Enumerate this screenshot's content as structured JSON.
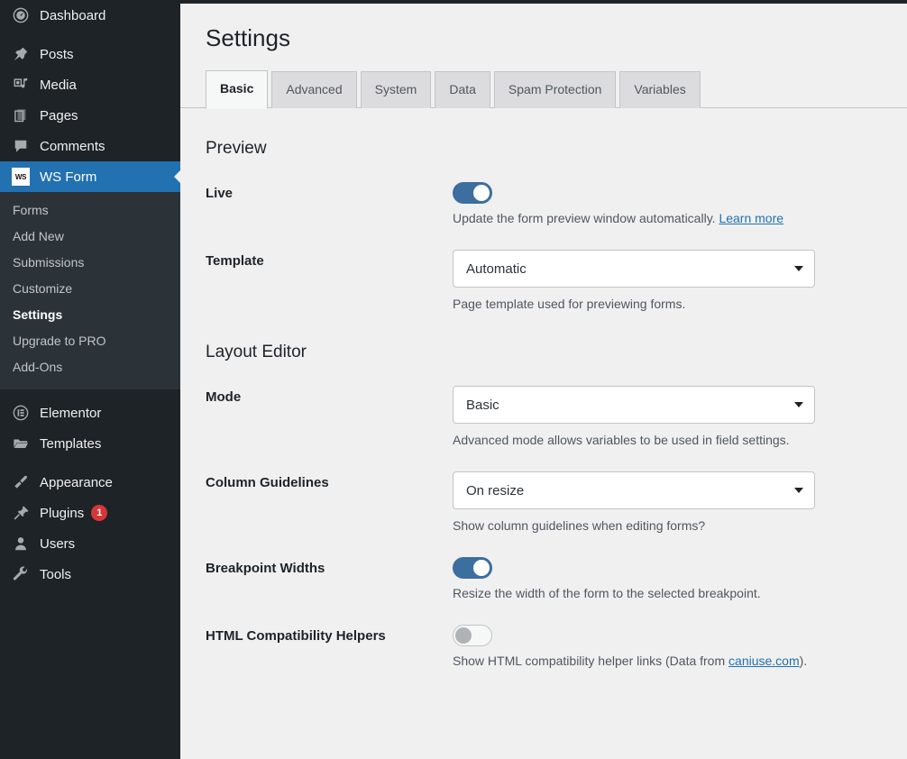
{
  "sidebar": {
    "items": [
      {
        "label": "Dashboard",
        "icon": "dashboard-icon",
        "current": false
      },
      {
        "label": "Posts",
        "icon": "pin-icon",
        "current": false
      },
      {
        "label": "Media",
        "icon": "media-icon",
        "current": false
      },
      {
        "label": "Pages",
        "icon": "pages-icon",
        "current": false
      },
      {
        "label": "Comments",
        "icon": "comments-icon",
        "current": false
      },
      {
        "label": "WS Form",
        "icon": "ws-form-icon",
        "current": true
      },
      {
        "label": "Elementor",
        "icon": "elementor-icon",
        "current": false
      },
      {
        "label": "Templates",
        "icon": "templates-icon",
        "current": false
      },
      {
        "label": "Appearance",
        "icon": "appearance-icon",
        "current": false
      },
      {
        "label": "Plugins",
        "icon": "plugins-icon",
        "current": false,
        "badge": "1"
      },
      {
        "label": "Users",
        "icon": "users-icon",
        "current": false
      },
      {
        "label": "Tools",
        "icon": "tools-icon",
        "current": false
      }
    ],
    "ws_form_badge_text": "WS",
    "submenu": [
      {
        "label": "Forms",
        "current": false
      },
      {
        "label": "Add New",
        "current": false
      },
      {
        "label": "Submissions",
        "current": false
      },
      {
        "label": "Customize",
        "current": false
      },
      {
        "label": "Settings",
        "current": true
      },
      {
        "label": "Upgrade to PRO",
        "current": false
      },
      {
        "label": "Add-Ons",
        "current": false
      }
    ]
  },
  "page": {
    "title": "Settings",
    "tabs": [
      {
        "label": "Basic",
        "active": true
      },
      {
        "label": "Advanced",
        "active": false
      },
      {
        "label": "System",
        "active": false
      },
      {
        "label": "Data",
        "active": false
      },
      {
        "label": "Spam Protection",
        "active": false
      },
      {
        "label": "Variables",
        "active": false
      }
    ]
  },
  "preview": {
    "heading": "Preview",
    "live": {
      "label": "Live",
      "state": "on",
      "help_text": "Update the form preview window automatically.",
      "help_link": "Learn more"
    },
    "template": {
      "label": "Template",
      "value": "Automatic",
      "help_text": "Page template used for previewing forms."
    }
  },
  "layout_editor": {
    "heading": "Layout Editor",
    "mode": {
      "label": "Mode",
      "value": "Basic",
      "help_text": "Advanced mode allows variables to be used in field settings."
    },
    "column_guidelines": {
      "label": "Column Guidelines",
      "value": "On resize",
      "help_text": "Show column guidelines when editing forms?"
    },
    "breakpoint_widths": {
      "label": "Breakpoint Widths",
      "state": "on",
      "help_text": "Resize the width of the form to the selected breakpoint."
    },
    "html_compatibility_helpers": {
      "label": "HTML Compatibility Helpers",
      "state": "off",
      "help_text_before": "Show HTML compatibility helper links (Data from ",
      "help_link": "caniuse.com",
      "help_text_after": ")."
    }
  },
  "colors": {
    "sidebar_bg": "#1d2327",
    "submenu_bg": "#2c3338",
    "accent_blue": "#2271b1",
    "toggle_on": "#3c6e9f",
    "badge_red": "#d63638",
    "content_bg": "#f0f0f1"
  }
}
